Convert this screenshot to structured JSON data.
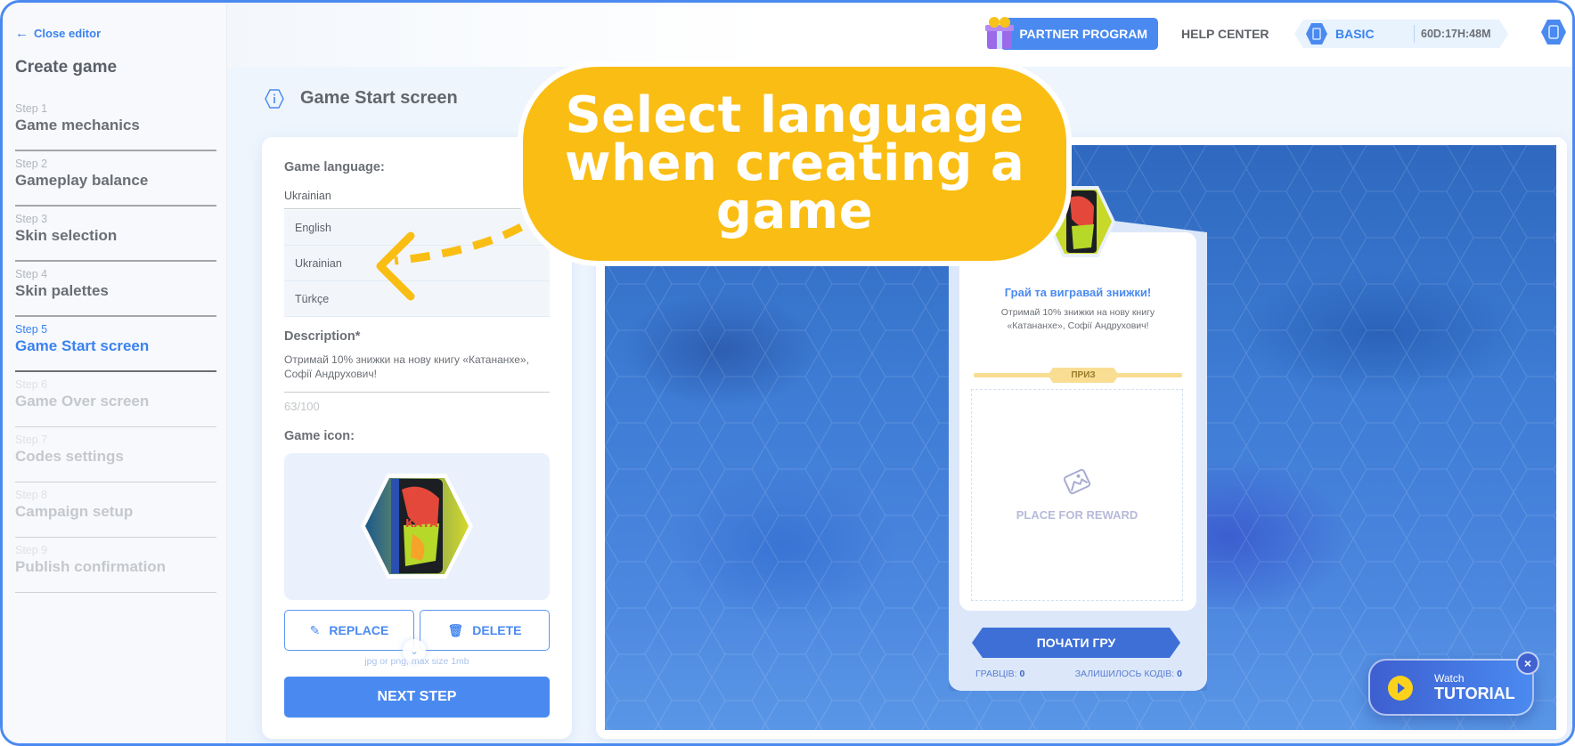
{
  "sidebar": {
    "close_label": "Close editor",
    "title": "Create game",
    "steps": [
      {
        "num": "Step 1",
        "label": "Game mechanics",
        "state": "done"
      },
      {
        "num": "Step 2",
        "label": "Gameplay balance",
        "state": "done"
      },
      {
        "num": "Step 3",
        "label": "Skin selection",
        "state": "done"
      },
      {
        "num": "Step 4",
        "label": "Skin palettes",
        "state": "done"
      },
      {
        "num": "Step 5",
        "label": "Game Start screen",
        "state": "active"
      },
      {
        "num": "Step 6",
        "label": "Game Over screen",
        "state": "disabled"
      },
      {
        "num": "Step 7",
        "label": "Codes settings",
        "state": "disabled"
      },
      {
        "num": "Step 8",
        "label": "Campaign setup",
        "state": "disabled"
      },
      {
        "num": "Step 9",
        "label": "Publish confirmation",
        "state": "disabled"
      }
    ]
  },
  "header": {
    "partner_label": "PARTNER PROGRAM",
    "help_label": "HELP CENTER",
    "plan_name": "BASIC",
    "plan_timer": "60D:17H:48M"
  },
  "main": {
    "page_title": "Game Start screen",
    "form": {
      "language_label": "Game language:",
      "language_selected": "Ukrainian",
      "language_options": [
        "English",
        "Ukrainian",
        "Türkçe"
      ],
      "description_label": "Description*",
      "description_value": "Отримай 10% знижки на нову книгу «Катананхе», Софії Андрухович!",
      "description_count": "63/100",
      "icon_label": "Game icon:",
      "replace_label": "REPLACE",
      "delete_label": "DELETE",
      "file_hint": "jpg or png, max size 1mb",
      "next_label": "NEXT STEP"
    },
    "preview": {
      "heading": "Грай та вигравай знижки!",
      "description": "Отримай 10% знижки на нову книгу «Катананхе», Софії Андрухович!",
      "prize_label": "ПРИЗ",
      "reward_placeholder": "PLACE FOR REWARD",
      "start_label": "ПОЧАТИ ГРУ",
      "players_label": "ГРАВЦІВ:",
      "players_value": "0",
      "codes_label": "ЗАЛИШИЛОСЬ КОДІВ:",
      "codes_value": "0"
    },
    "tutorial": {
      "watch_label": "Watch",
      "title": "TUTORIAL",
      "close_symbol": "×"
    }
  },
  "callout": {
    "text": "Select language when creating a game",
    "color": "#fabd13"
  },
  "colors": {
    "accent": "#4a8af0",
    "text_muted": "#6b6f75",
    "prize": "#f8dd93"
  }
}
